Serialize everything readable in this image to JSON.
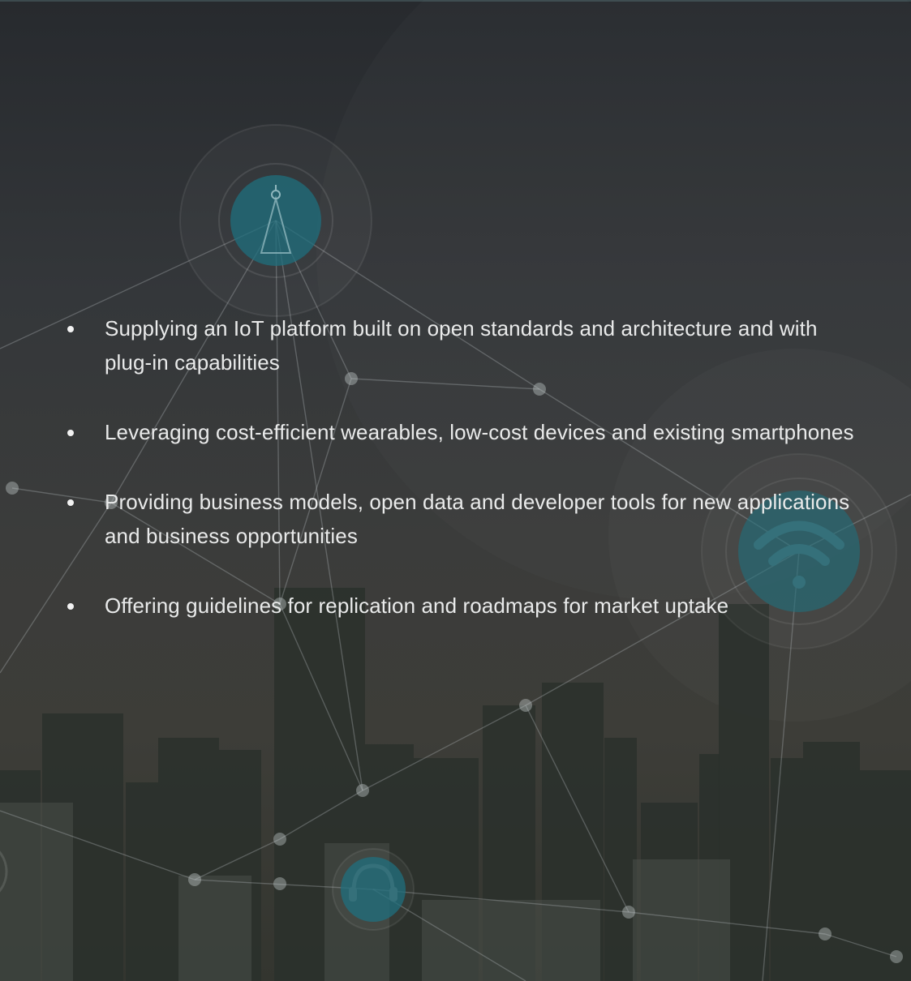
{
  "benefits": {
    "items": [
      {
        "text": "Supplying an IoT platform built on open standards and architecture and with plug-in capabilities"
      },
      {
        "text": "Leveraging cost-efficient wearables, low-cost devices and existing smartphones"
      },
      {
        "text": "Providing business models, open data and developer tools for new applications and business opportunities"
      },
      {
        "text": "Offering guidelines for replication and roadmaps for market uptake"
      }
    ]
  },
  "background": {
    "scene": "city-skyline-network",
    "icons": [
      "antenna-icon",
      "wifi-icon",
      "headset-icon"
    ],
    "colors": {
      "overlay": "#2f3235",
      "node_teal": "#1f6f7d",
      "line": "#9aa3a5",
      "text": "#e9eaea"
    }
  }
}
